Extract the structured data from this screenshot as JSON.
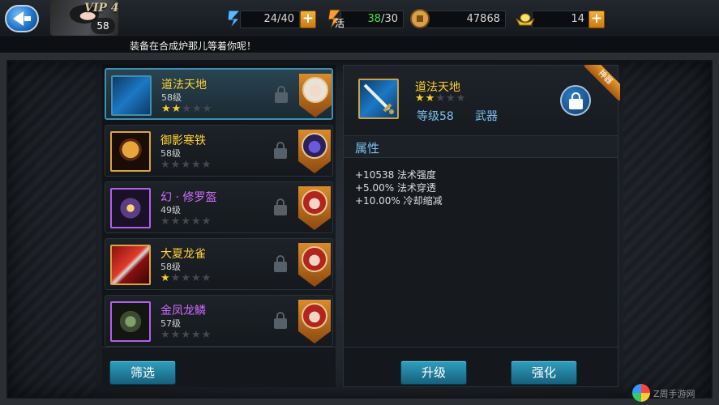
{
  "header": {
    "vip": "VIP 4",
    "player_level": "58",
    "stamina": {
      "value": "24",
      "max": "/40"
    },
    "energy_label": "活",
    "energy": {
      "value": "38",
      "max": "/30"
    },
    "coins": "47868",
    "gold": "14",
    "plus": "+"
  },
  "ticker": {
    "text": "装备在合成炉那儿等着你呢！"
  },
  "equipment_list": [
    {
      "name": "道法天地",
      "level": "58级",
      "stars": 2,
      "name_color": "#ffd234",
      "thumb": "sword",
      "hero": "white-hair"
    },
    {
      "name": "御影寒铁",
      "level": "58级",
      "stars": 0,
      "name_color": "#ffd234",
      "thumb": "helmet-gold",
      "hero": "blue-mask"
    },
    {
      "name": "幻 · 修罗盔",
      "level": "49级",
      "stars": 0,
      "name_color": "#d26bff",
      "thumb": "helmet-purple",
      "hero": "red-hair"
    },
    {
      "name": "大夏龙雀",
      "level": "58级",
      "stars": 1,
      "name_color": "#ffd234",
      "thumb": "blade-red",
      "hero": "red-hair"
    },
    {
      "name": "金凤龙鳞",
      "level": "57级",
      "stars": 0,
      "name_color": "#d26bff",
      "thumb": "armor",
      "hero": "red-hair"
    }
  ],
  "star_symbol": "★",
  "list_footer": {
    "filter_button": "筛选"
  },
  "detail": {
    "ribbon": "神器",
    "name": "道法天地",
    "stars": 2,
    "level": "等级58",
    "type": "武器",
    "attributes_title": "属性",
    "attributes": [
      "+10538 法术强度",
      "+5.00% 法术穿透",
      "+10.00% 冷却缩减"
    ],
    "upgrade_button": "升级",
    "enhance_button": "强化"
  },
  "watermark": "Z周手游网",
  "colors": {
    "accent_blue": "#2f9fbe",
    "gold_text": "#ffd234",
    "purple_text": "#d26bff",
    "selected_border": "#3f8fb3"
  }
}
